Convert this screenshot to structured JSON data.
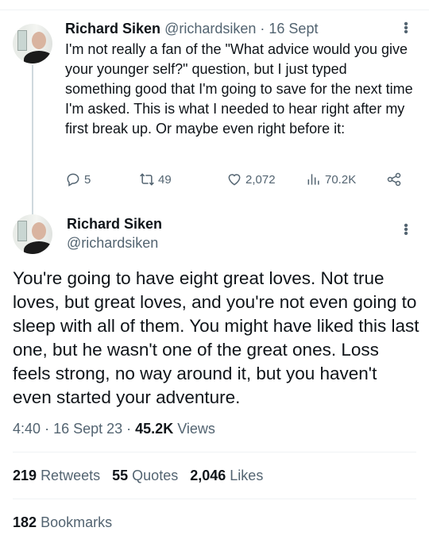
{
  "reply_tweet": {
    "author_name": "Richard Siken",
    "handle": "@richardsiken",
    "separator": "·",
    "date": "16 Sept",
    "text": "I'm not really a fan of the \"What advice would you give your younger self?\" question, but I just typed something good that I'm going to save for the next time I'm asked. This is what I needed to hear right after my first break up. Or maybe even right before it:",
    "actions": {
      "replies": "5",
      "retweets": "49",
      "likes": "2,072",
      "views": "70.2K"
    },
    "icons": [
      "reply-icon",
      "retweet-icon",
      "like-icon",
      "views-icon",
      "share-icon",
      "more-icon"
    ]
  },
  "main_tweet": {
    "author_name": "Richard Siken",
    "handle": "@richardsiken",
    "text": "You're going to have eight great loves. Not true loves, but great loves, and you're not even going to sleep with all of them. You might have liked this last one, but he wasn't one of the great ones. Loss feels strong, no way around it, but you haven't even started your adventure.",
    "time": "4:40",
    "date": "16 Sept 23",
    "views_count": "45.2K",
    "views_label": "Views",
    "stats": {
      "retweets_count": "219",
      "retweets_label": "Retweets",
      "quotes_count": "55",
      "quotes_label": "Quotes",
      "likes_count": "2,046",
      "likes_label": "Likes",
      "bookmarks_count": "182",
      "bookmarks_label": "Bookmarks"
    }
  },
  "colors": {
    "text": "#0f1419",
    "muted": "#536471",
    "divider": "#eff3f4",
    "thread_line": "#cfd9de"
  }
}
